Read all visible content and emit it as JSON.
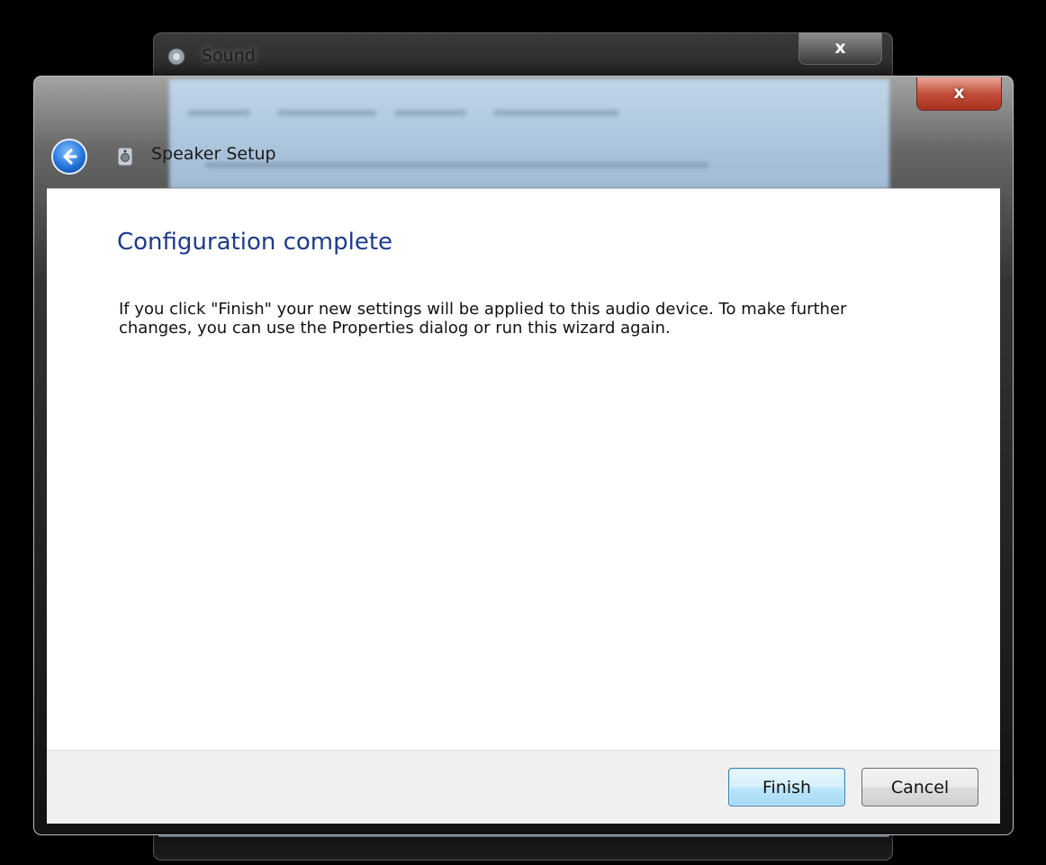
{
  "background_window": {
    "title": "Sound",
    "close_label": "x"
  },
  "window": {
    "title": "Speaker Setup",
    "close_label": "x"
  },
  "content": {
    "heading": "Configuration complete",
    "body": "If you click \"Finish\" your new settings will be applied to this audio device.  To make further changes, you can use the Properties dialog or run this wizard again."
  },
  "buttons": {
    "finish": "Finish",
    "cancel": "Cancel"
  },
  "icons": {
    "back": "back-arrow-icon",
    "wizard": "speaker-icon",
    "sound": "sound-icon"
  },
  "colors": {
    "heading": "#1e3a8a",
    "close_red": "#c3503b",
    "primary_button_border": "#3c7fb1"
  }
}
